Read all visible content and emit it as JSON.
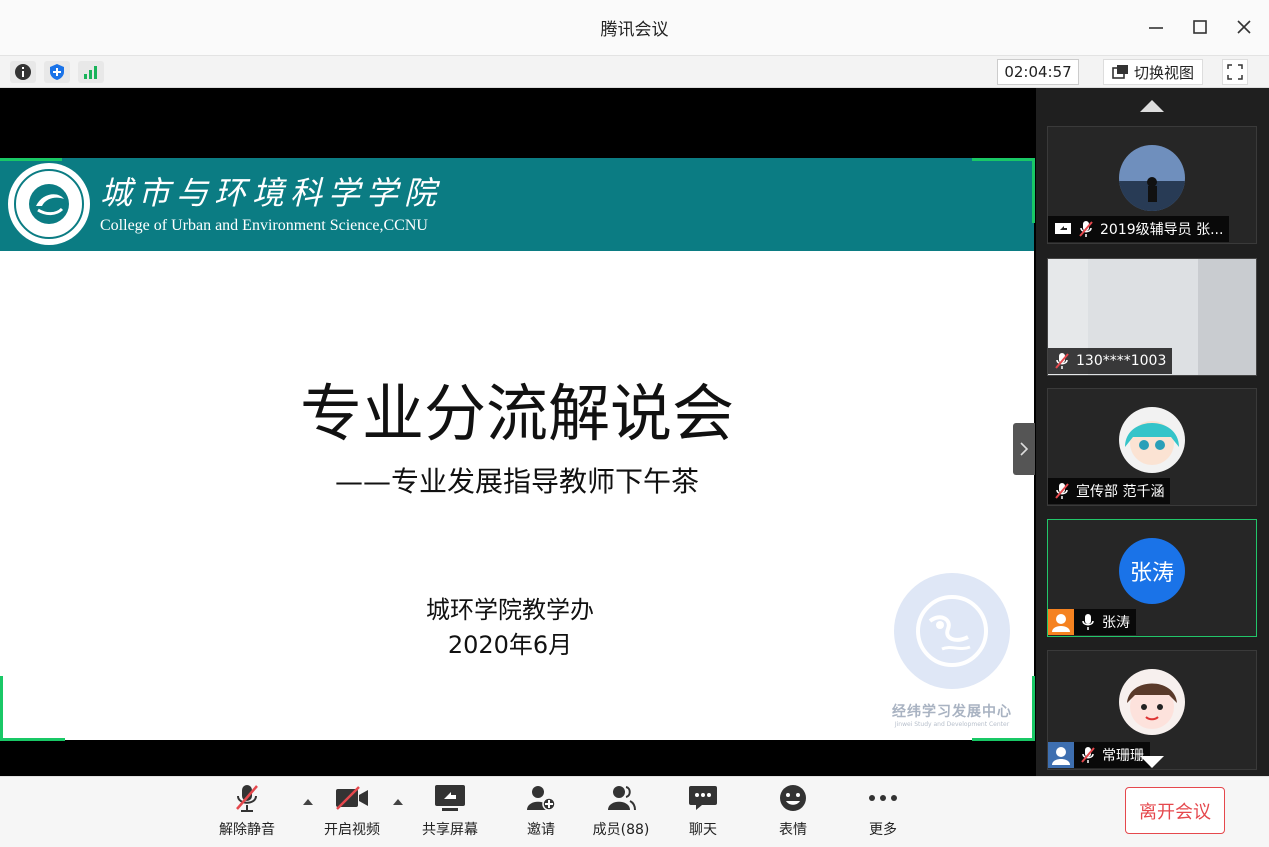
{
  "window": {
    "title": "腾讯会议"
  },
  "toolbar": {
    "timer": "02:04:57",
    "switch_view_label": "切换视图"
  },
  "slide": {
    "college_cn": "城市与环境科学学院",
    "college_en": "College of Urban and Environment Science,CCNU",
    "title": "专业分流解说会",
    "subtitle": "——专业发展指导教师下午茶",
    "organizer": "城环学院教学办",
    "date": "2020年6月",
    "watermark_text": "经纬学习发展中心",
    "watermark_sub": "Jinwei Study and Development Center"
  },
  "participants": [
    {
      "name": "2019级辅导员 张...",
      "muted": true,
      "sharing": true
    },
    {
      "name": "130****1003",
      "muted": true
    },
    {
      "name": "宣传部 范千涵",
      "muted": true
    },
    {
      "name": "张涛",
      "avatar_text": "张涛",
      "muted": false,
      "host": true,
      "speaking": true
    },
    {
      "name": "常珊珊",
      "muted": true,
      "host": true
    }
  ],
  "bottom": {
    "unmute_label": "解除静音",
    "video_label": "开启视频",
    "share_label": "共享屏幕",
    "invite_label": "邀请",
    "members_label": "成员(88)",
    "chat_label": "聊天",
    "emoji_label": "表情",
    "more_label": "更多",
    "leave_label": "离开会议"
  },
  "colors": {
    "accent_green": "#19c866",
    "leave_red": "#e5484d",
    "banner_teal": "#0b7c83",
    "avatar_blue": "#1a73e8"
  }
}
